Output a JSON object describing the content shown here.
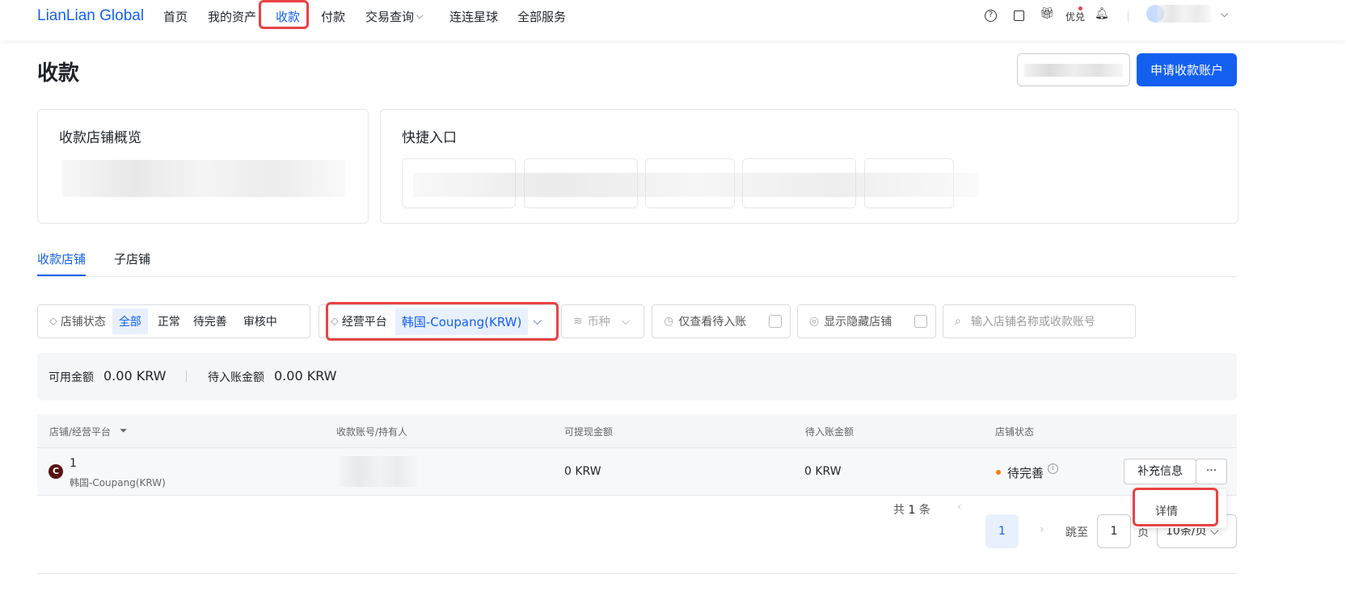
{
  "nav": {
    "logo": "LianLian Global",
    "items": [
      "首页",
      "我的资产",
      "收款",
      "付款",
      "交易查询",
      "连连星球",
      "全部服务"
    ],
    "youdui": "优兑"
  },
  "page": {
    "title": "收款",
    "apply_button": "申请收款账户"
  },
  "overview": {
    "title": "收款店铺概览"
  },
  "quick": {
    "title": "快捷入口"
  },
  "tabs": [
    "收款店铺",
    "子店铺"
  ],
  "filters": {
    "status_label": "店铺状态",
    "status_options": [
      "全部",
      "正常",
      "待完善",
      "审核中"
    ],
    "platform_label": "经营平台",
    "platform_value": "韩国-Coupang(KRW)",
    "currency_placeholder": "币种",
    "pending_only": "仅查看待入账",
    "show_hidden": "显示隐藏店铺",
    "search_placeholder": "输入店铺名称或收款账号"
  },
  "summary": {
    "available_label": "可用金额",
    "available_value": "0.00 KRW",
    "pending_label": "待入账金额",
    "pending_value": "0.00 KRW"
  },
  "table": {
    "headers": [
      "店铺/经营平台",
      "收款账号/持有人",
      "可提现金额",
      "待入账金额",
      "店铺状态"
    ],
    "rows": [
      {
        "avatar": "C",
        "name": "1",
        "platform": "韩国-Coupang(KRW)",
        "withdrawable": "0 KRW",
        "pending": "0 KRW",
        "status": "待完善",
        "action": "补充信息",
        "more": "···"
      }
    ]
  },
  "menu": {
    "details": "详情"
  },
  "pagination": {
    "total_prefix": "共",
    "total": "1",
    "total_suffix": "条",
    "current": "1",
    "jump_label": "跳至",
    "jump_value": "1",
    "page_suffix": "页",
    "page_size": "10条/页"
  },
  "colors": {
    "accent": "#1360f0",
    "highlight": "#e84343",
    "status_pending": "#ff7d00"
  }
}
